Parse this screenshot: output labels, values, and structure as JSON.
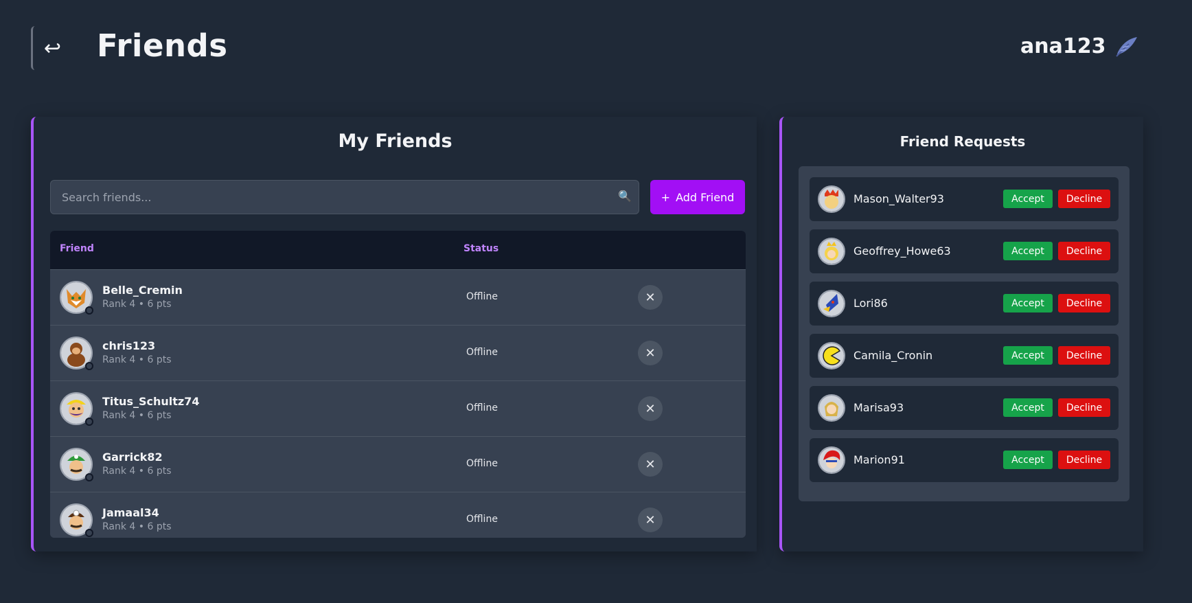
{
  "header": {
    "back_icon": "back-arrow-icon",
    "back_glyph": "↩",
    "title": "Friends",
    "username": "ana123",
    "user_icon": "feather-icon"
  },
  "friends_panel": {
    "title": "My Friends",
    "search": {
      "placeholder": "Search friends...",
      "value": "",
      "icon": "search-icon",
      "icon_glyph": "🔍"
    },
    "add_button": {
      "plus": "+",
      "label": "Add Friend"
    },
    "columns": {
      "friend": "Friend",
      "status": "Status"
    },
    "friends": [
      {
        "name": "Belle_Cremin",
        "meta": "Rank 4 • 6 pts",
        "status": "Offline",
        "avatar": "fox-avatar"
      },
      {
        "name": "chris123",
        "meta": "Rank 4 • 6 pts",
        "status": "Offline",
        "avatar": "donkey-kong-avatar"
      },
      {
        "name": "Titus_Schultz74",
        "meta": "Rank 4 • 6 pts",
        "status": "Offline",
        "avatar": "wario-avatar"
      },
      {
        "name": "Garrick82",
        "meta": "Rank 4 • 6 pts",
        "status": "Offline",
        "avatar": "luigi-avatar"
      },
      {
        "name": "Jamaal34",
        "meta": "Rank 4 • 6 pts",
        "status": "Offline",
        "avatar": "doctor-avatar"
      }
    ],
    "remove_glyph": "✕"
  },
  "requests_panel": {
    "title": "Friend Requests",
    "accept_label": "Accept",
    "decline_label": "Decline",
    "requests": [
      {
        "name": "Mason_Walter93",
        "avatar": "bowser-avatar"
      },
      {
        "name": "Geoffrey_Howe63",
        "avatar": "peach-avatar"
      },
      {
        "name": "Lori86",
        "avatar": "falco-avatar"
      },
      {
        "name": "Camila_Cronin",
        "avatar": "pacman-avatar"
      },
      {
        "name": "Marisa93",
        "avatar": "link-avatar"
      },
      {
        "name": "Marion91",
        "avatar": "roy-avatar"
      }
    ]
  },
  "colors": {
    "accent": "#a855f7",
    "add_button": "#a20ff5",
    "accept": "#16a34a",
    "decline": "#dc1010",
    "background": "#1f2937"
  }
}
